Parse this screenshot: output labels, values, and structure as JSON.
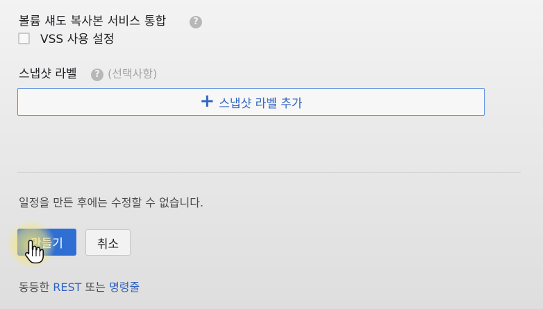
{
  "vss_section": {
    "title": "볼륨 섀도 복사본 서비스 통합",
    "help_glyph": "?",
    "checkbox_label": "VSS 사용 설정",
    "checked": false
  },
  "labels_section": {
    "title": "스냅샷 라벨",
    "help_glyph": "?",
    "optional_text": "(선택사항)",
    "add_button_icon": "+",
    "add_button_label": "스냅샷 라벨 추가"
  },
  "notice": "일정을 만든 후에는 수정할 수 없습니다.",
  "actions": {
    "create_label": "만들기",
    "cancel_label": "취소"
  },
  "footer": {
    "prefix": "동등한",
    "rest_link": "REST",
    "middle": "또는",
    "cli_link": "명령줄"
  },
  "colors": {
    "accent": "#2f6fd3",
    "link": "#2f62c0",
    "outline_button_border": "#5a8fe0",
    "cursor_highlight": "#f6e478"
  },
  "icons": [
    "help-icon",
    "plus-icon",
    "hand-pointer-icon"
  ]
}
